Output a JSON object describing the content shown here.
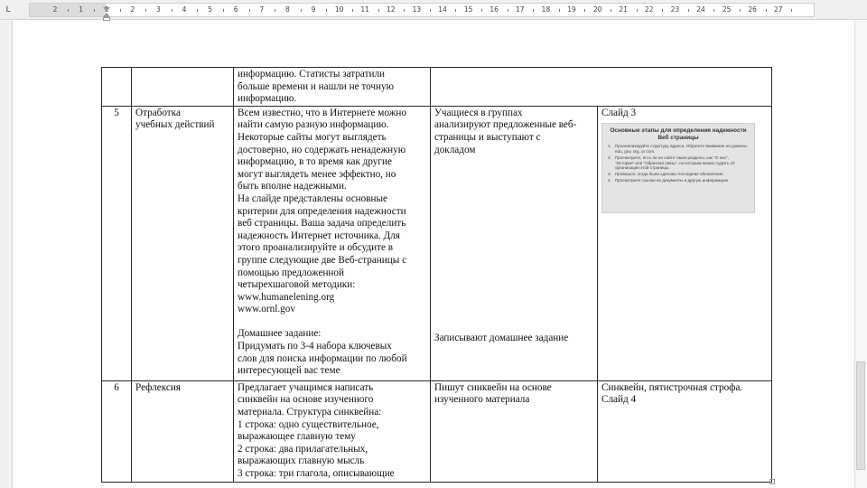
{
  "ruler": {
    "numbers": [
      "2",
      "1",
      "1",
      "2",
      "3",
      "4",
      "5",
      "6",
      "7",
      "8",
      "9",
      "10",
      "11",
      "12",
      "13",
      "14",
      "15",
      "16",
      "17",
      "18",
      "19",
      "20",
      "21",
      "22",
      "23",
      "24",
      "25",
      "26",
      "27"
    ]
  },
  "table": {
    "rows": [
      {
        "num": "",
        "stage": [],
        "teacher": [
          "информацию. Статисты затратили",
          "больше времени и нашли не точную",
          "информацию."
        ],
        "students": [],
        "notes": []
      },
      {
        "num": "5",
        "stage": [
          "Отработка",
          "учебных действий"
        ],
        "teacher": [
          "Всем известно, что в Интернете можно",
          "найти самую разную информацию.",
          "Некоторые сайты могут выглядеть",
          "достоверно, но содержать ненадежную",
          "информацию, в то время как другие",
          "могут выглядеть менее эффектно, но",
          "быть вполне надежными.",
          "На слайде представлены основные",
          "критерии для определения надежности",
          "веб страницы. Ваша задача определить",
          "надежность Интернет источника. Для",
          "этого проанализируйте и обсудите в",
          "группе следующие две Веб-страницы с",
          "помощью предложенной",
          "четырехшаговой методики:",
          "www.humanelening.org",
          "www.ornl.gov",
          "",
          "Домашнее задание:",
          "Придумать по 3-4 набора ключевых",
          "слов для поиска информации по любой",
          "интересующей вас теме"
        ],
        "students": [
          "Учащиеся в группах",
          "анализируют предложенные веб-",
          "страницы и выступают с",
          "докладом"
        ],
        "students_bottom": "Записывают домашнее задание",
        "notes": [
          "Слайд 3"
        ]
      },
      {
        "num": "6",
        "stage": [
          "Рефлексия"
        ],
        "teacher": [
          "Предлагает учащимся написать",
          "синквейн на основе изученного",
          "материала. Структура синквейна:",
          "1 строка: одно существительное,",
          "выражающее главную тему",
          "2 строка: два прилагательных,",
          "выражающих главную мысль",
          "3 строка: три глагола, описывающие"
        ],
        "students": [
          "Пишут синквейн на основе",
          "изученного материала"
        ],
        "notes": [
          "Синквейн, пятистрочная строфа.",
          "Слайд 4"
        ]
      }
    ],
    "slide": {
      "title": "Основные этапы для определения надежности Веб страницы",
      "items": [
        {
          "n": "1.",
          "text": "Проанализируйте структуру адреса. Обратите внимание на домены edu, gov, org, or com."
        },
        {
          "n": "2.",
          "text": "Просмотрите, есть ли на сайте такие разделы, как \"О нас\", \"История\" или \"Обратная связь\", по которым можно судить об организации этой страницы."
        },
        {
          "n": "3.",
          "text": "Проверьте, когда были сделаны последние обновления."
        },
        {
          "n": "4.",
          "text": "Просмотрите ссылки на документы и другую информацию."
        }
      ]
    }
  }
}
